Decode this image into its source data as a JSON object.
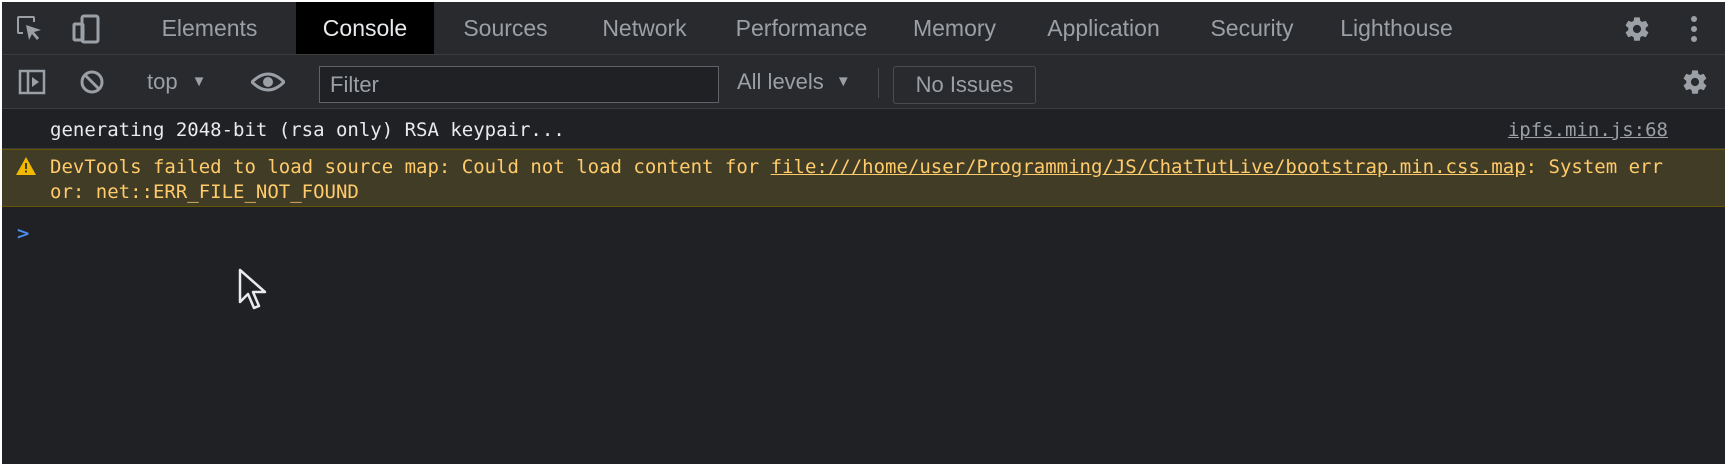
{
  "tabs": [
    {
      "label": "Elements",
      "active": false
    },
    {
      "label": "Console",
      "active": true
    },
    {
      "label": "Sources",
      "active": false
    },
    {
      "label": "Network",
      "active": false
    },
    {
      "label": "Performance",
      "active": false
    },
    {
      "label": "Memory",
      "active": false
    },
    {
      "label": "Application",
      "active": false
    },
    {
      "label": "Security",
      "active": false
    },
    {
      "label": "Lighthouse",
      "active": false
    }
  ],
  "tabbar_icons": [
    "inspect-element-icon",
    "device-toolbar-icon",
    "settings-gear-icon",
    "more-options-icon"
  ],
  "toolbar": {
    "context": "top",
    "filter_placeholder": "Filter",
    "levels": "All levels",
    "issues": "No Issues"
  },
  "console": {
    "messages": [
      {
        "level": "info",
        "text": "generating 2048-bit (rsa only) RSA keypair...",
        "source": "ipfs.min.js:68"
      },
      {
        "level": "warning",
        "prefix": "DevTools failed to load source map: Could not load content for ",
        "link": "file:///home/user/Programming/JS/ChatTutLive/bootstrap.min.css.map",
        "suffix": ": System error: net::ERR_FILE_NOT_FOUND"
      }
    ],
    "prompt_symbol": ">"
  },
  "colors": {
    "background": "#202124",
    "toolbar": "#292a2d",
    "active_tab": "#000000",
    "warning_bg": "#413c26",
    "warning_text": "#ffcb6b",
    "prompt": "#4e8cf1"
  }
}
